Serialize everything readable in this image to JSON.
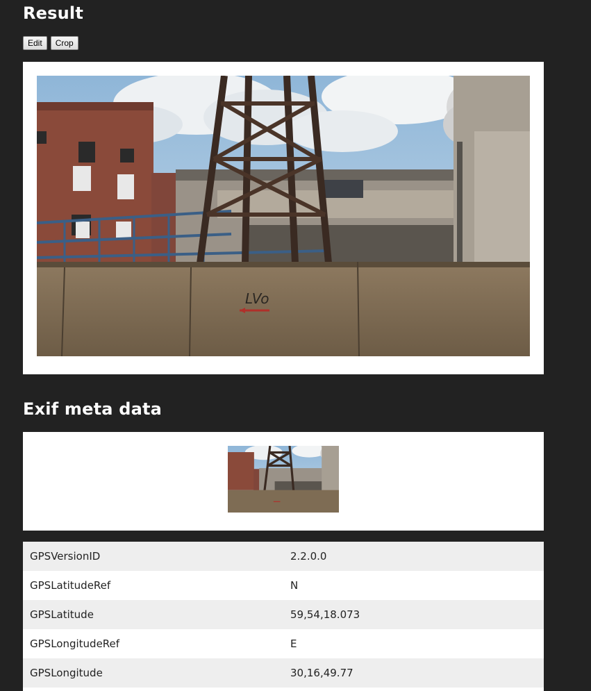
{
  "result": {
    "title": "Result",
    "edit_label": "Edit",
    "crop_label": "Crop"
  },
  "photo": {
    "graffiti_text": "LVo"
  },
  "exif": {
    "title": "Exif meta data",
    "rows": [
      {
        "key": "GPSVersionID",
        "value": "2.2.0.0"
      },
      {
        "key": "GPSLatitudeRef",
        "value": "N"
      },
      {
        "key": "GPSLatitude",
        "value": "59,54,18.073"
      },
      {
        "key": "GPSLongitudeRef",
        "value": "E"
      },
      {
        "key": "GPSLongitude",
        "value": "30,16,49.77"
      },
      {
        "key": "",
        "value": ""
      }
    ]
  }
}
